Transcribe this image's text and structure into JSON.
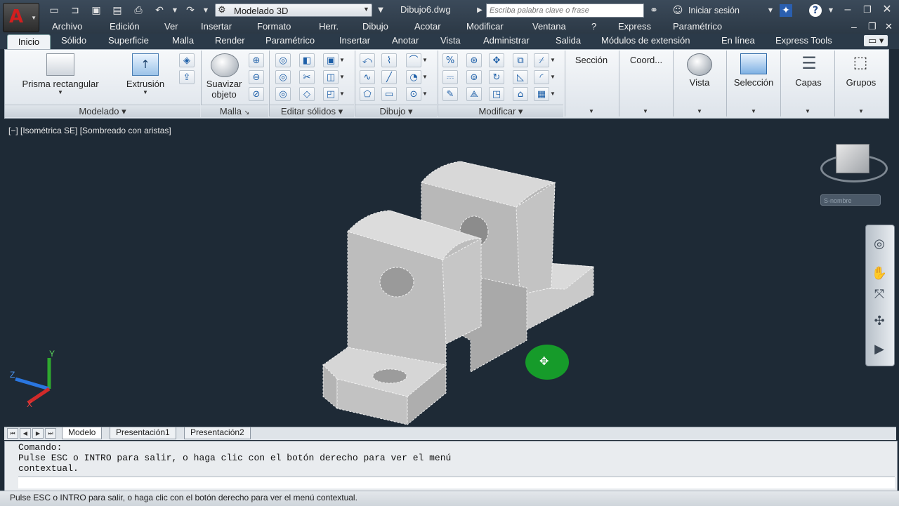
{
  "titlebar": {
    "workspace": "Modelado 3D",
    "drawing_title": "Dibujo6.dwg",
    "search_placeholder": "Escriba palabra clave o frase",
    "login": "Iniciar sesión",
    "help": "?"
  },
  "menubar": [
    "Archivo",
    "Edición",
    "Ver",
    "Insertar",
    "Formato",
    "Herr.",
    "Dibujo",
    "Acotar",
    "Modificar",
    "Ventana",
    "?",
    "Express",
    "Paramétrico"
  ],
  "tabs": [
    "Inicio",
    "Sólido",
    "Superficie",
    "Malla",
    "Render",
    "Paramétrico",
    "Insertar",
    "Anotar",
    "Vista",
    "Administrar",
    "Salida",
    "Módulos de extensión",
    "En línea",
    "Express Tools"
  ],
  "ribbon": {
    "modelado": {
      "title": "Modelado",
      "box": "Prisma rectangular",
      "extrude": "Extrusión"
    },
    "malla": {
      "title": "Malla",
      "smooth_line1": "Suavizar",
      "smooth_line2": "objeto"
    },
    "editar": {
      "title": "Editar sólidos"
    },
    "dibujo": {
      "title": "Dibujo"
    },
    "modificar": {
      "title": "Modificar"
    },
    "seccion": "Sección",
    "coord": "Coord...",
    "vista": "Vista",
    "seleccion": "Selección",
    "capas": "Capas",
    "grupos": "Grupos"
  },
  "viewport": {
    "label": "[−] [Isométrica SE] [Sombreado con aristas]",
    "wcs": "S-nombre",
    "axis_y": "Y",
    "axis_z": "Z",
    "axis_x": "X"
  },
  "layout_tabs": [
    "Modelo",
    "Presentación1",
    "Presentación2"
  ],
  "command": {
    "lines": "Comando:\nPulse ESC o INTRO para salir, o haga clic con el botón derecho para ver el menú\ncontextual."
  },
  "status": "Pulse ESC o INTRO para salir, o haga clic con el botón derecho para ver el menú contextual.",
  "colors": {
    "accent": "#d21f1f",
    "cursor": "#169b2a",
    "background": "#1e2a36"
  }
}
